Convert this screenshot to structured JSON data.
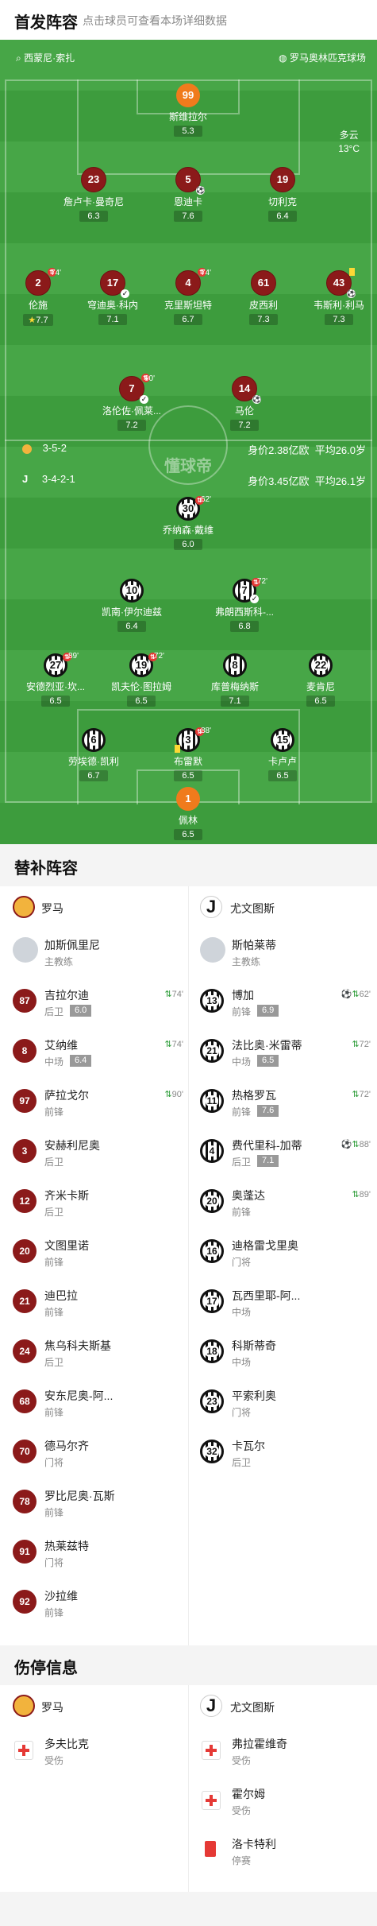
{
  "header": {
    "title": "首发阵容",
    "subtitle": "点击球员可查看本场详细数据"
  },
  "pitch": {
    "home_coach_label": "西蒙尼·索扎",
    "stadium": "罗马奥林匹克球场",
    "weather": "多云",
    "temperature": "13°C",
    "watermark": "懂球帝",
    "roma_formation": "3-5-2",
    "roma_value": "身价2.38亿欧",
    "roma_age": "平均26.0岁",
    "juve_formation": "3-4-2-1",
    "juve_value": "身价3.45亿欧",
    "juve_age": "平均26.1岁",
    "roma_players": [
      {
        "num": "99",
        "name": "斯维拉尔",
        "rating": "5.3",
        "gk": true
      },
      {
        "num": "23",
        "name": "詹卢卡·曼奇尼",
        "rating": "6.3"
      },
      {
        "num": "5",
        "name": "恩迪卡",
        "rating": "7.6"
      },
      {
        "num": "19",
        "name": "切利克",
        "rating": "6.4"
      },
      {
        "num": "2",
        "name": "伦施",
        "rating": "7.7",
        "min": "74'"
      },
      {
        "num": "17",
        "name": "穹迪奥·科内",
        "rating": "7.1"
      },
      {
        "num": "4",
        "name": "克里斯坦特",
        "rating": "6.7",
        "min": "74'"
      },
      {
        "num": "61",
        "name": "皮西利",
        "rating": "7.3"
      },
      {
        "num": "43",
        "name": "韦斯利·利马",
        "rating": "7.3"
      },
      {
        "num": "7",
        "name": "洛伦佐·佩莱...",
        "rating": "7.2",
        "min": "90'"
      },
      {
        "num": "14",
        "name": "马伦",
        "rating": "7.2"
      }
    ],
    "juve_players": [
      {
        "num": "30",
        "name": "乔纳森·戴维",
        "rating": "6.0",
        "min": "62'"
      },
      {
        "num": "10",
        "name": "凯南·伊尔迪兹",
        "rating": "6.4"
      },
      {
        "num": "7",
        "name": "弗朗西斯科-...",
        "rating": "6.8",
        "min": "72'"
      },
      {
        "num": "27",
        "name": "安德烈亚·坎...",
        "rating": "6.5",
        "min": "89'"
      },
      {
        "num": "19",
        "name": "凯夫伦·图拉姆",
        "rating": "6.5",
        "min": "72'"
      },
      {
        "num": "8",
        "name": "库普梅纳斯",
        "rating": "7.1"
      },
      {
        "num": "22",
        "name": "麦肯尼",
        "rating": "6.5"
      },
      {
        "num": "6",
        "name": "劳埃德·凯利",
        "rating": "6.7"
      },
      {
        "num": "3",
        "name": "布雷默",
        "rating": "6.5",
        "min": "88'"
      },
      {
        "num": "15",
        "name": "卡卢卢",
        "rating": "6.5"
      },
      {
        "num": "1",
        "name": "佩林",
        "rating": "6.5",
        "gk": true
      }
    ]
  },
  "subs": {
    "title": "替补阵容",
    "home_team": "罗马",
    "away_team": "尤文图斯",
    "home_coach": {
      "name": "加斯佩里尼",
      "role": "主教练"
    },
    "away_coach": {
      "name": "斯帕莱蒂",
      "role": "主教练"
    },
    "home": [
      {
        "num": "87",
        "name": "吉拉尔迪",
        "pos": "后卫",
        "rating": "6.0",
        "min": "74'"
      },
      {
        "num": "8",
        "name": "艾纳维",
        "pos": "中场",
        "rating": "6.4",
        "min": "74'"
      },
      {
        "num": "97",
        "name": "萨拉戈尔",
        "pos": "前锋",
        "min": "90'"
      },
      {
        "num": "3",
        "name": "安赫利尼奥",
        "pos": "后卫"
      },
      {
        "num": "12",
        "name": "齐米卡斯",
        "pos": "后卫"
      },
      {
        "num": "20",
        "name": "文图里诺",
        "pos": "前锋"
      },
      {
        "num": "21",
        "name": "迪巴拉",
        "pos": "前锋"
      },
      {
        "num": "24",
        "name": "焦乌科夫斯基",
        "pos": "后卫"
      },
      {
        "num": "68",
        "name": "安东尼奥-阿...",
        "pos": "前锋"
      },
      {
        "num": "70",
        "name": "德马尔齐",
        "pos": "门将"
      },
      {
        "num": "78",
        "name": "罗比尼奥·瓦斯",
        "pos": "前锋"
      },
      {
        "num": "91",
        "name": "热莱兹特",
        "pos": "门将"
      },
      {
        "num": "92",
        "name": "沙拉维",
        "pos": "前锋"
      }
    ],
    "away": [
      {
        "num": "13",
        "name": "博加",
        "pos": "前锋",
        "rating": "6.9",
        "min": "62'",
        "goal": true
      },
      {
        "num": "21",
        "name": "法比奥·米雷蒂",
        "pos": "中场",
        "rating": "6.5",
        "min": "72'"
      },
      {
        "num": "11",
        "name": "热格罗瓦",
        "pos": "前锋",
        "rating": "7.6",
        "min": "72'"
      },
      {
        "num": "4",
        "name": "费代里科-加蒂",
        "pos": "后卫",
        "rating": "7.1",
        "min": "88'",
        "goal": true
      },
      {
        "num": "20",
        "name": "奥蓬达",
        "pos": "前锋",
        "min": "89'"
      },
      {
        "num": "16",
        "name": "迪格雷戈里奥",
        "pos": "门将"
      },
      {
        "num": "17",
        "name": "瓦西里耶-阿...",
        "pos": "中场"
      },
      {
        "num": "18",
        "name": "科斯蒂奇",
        "pos": "中场"
      },
      {
        "num": "23",
        "name": "平索利奥",
        "pos": "门将"
      },
      {
        "num": "32",
        "name": "卡瓦尔",
        "pos": "后卫"
      }
    ]
  },
  "injuries": {
    "title": "伤停信息",
    "home_team": "罗马",
    "away_team": "尤文图斯",
    "home": [
      {
        "name": "多夫比克",
        "status": "受伤"
      }
    ],
    "away": [
      {
        "name": "弗拉霍维奇",
        "status": "受伤"
      },
      {
        "name": "霍尔姆",
        "status": "受伤"
      },
      {
        "name": "洛卡特利",
        "status": "停赛"
      }
    ]
  },
  "colors": {
    "pitch": "#3d9c3d",
    "roma": "#8b1a1a",
    "gk": "#f07b1c",
    "sub_green": "#2e9d3a"
  }
}
